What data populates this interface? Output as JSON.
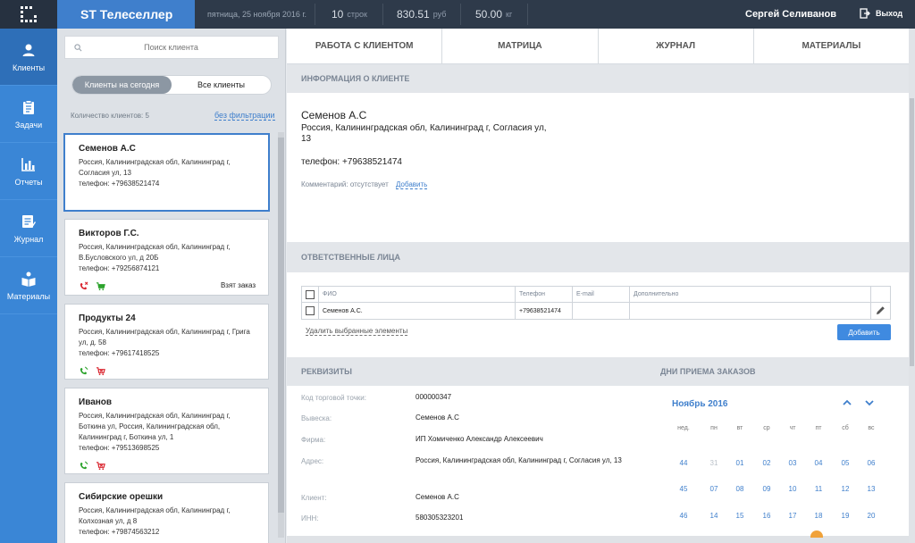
{
  "topbar": {
    "app_name": "ST Телеселлер",
    "date": "пятница, 25 ноября 2016 г.",
    "rows_count": "10",
    "rows_label": "строк",
    "sum_value": "830.51",
    "sum_unit": "руб",
    "weight_value": "50.00",
    "weight_unit": "кг",
    "user_name": "Сергей Селиванов",
    "logout_label": "Выход"
  },
  "sidebar": {
    "items": [
      {
        "label": "Клиенты",
        "icon": "person-icon"
      },
      {
        "label": "Задачи",
        "icon": "clipboard-icon"
      },
      {
        "label": "Отчеты",
        "icon": "bar-chart-icon"
      },
      {
        "label": "Журнал",
        "icon": "journal-icon"
      },
      {
        "label": "Материалы",
        "icon": "book-icon"
      }
    ]
  },
  "clients": {
    "search_placeholder": "Поиск клиента",
    "toggle_today": "Клиенты на сегодня",
    "toggle_all": "Все клиенты",
    "count_text": "Количество клиентов: 5",
    "no_filter": "без фильтрации",
    "cards": [
      {
        "name": "Семенов А.С",
        "address": "Россия, Калининградская обл, Калининград г, Согласия ул, 13",
        "phone": "телефон: +79638521474"
      },
      {
        "name": "Викторов Г.С.",
        "address": "Россия, Калининградская обл, Калининград г, В.Бусловского ул, д 20Б",
        "phone": "телефон: +79256874121",
        "status": "Взят заказ"
      },
      {
        "name": "Продукты 24",
        "address": "Россия, Калининградская обл, Калининград г, Грига ул, д. 58",
        "phone": "телефон: +79617418525"
      },
      {
        "name": "Иванов",
        "address": "Россия, Калининградская обл, Калининград г, Боткина ул, Россия, Калининградская обл, Калининград г, Боткина ул, 1",
        "phone": "телефон: +79513698525"
      },
      {
        "name": "Сибирские орешки",
        "address": "Россия, Калининградская обл, Калининград г, Колхозная ул, д 8",
        "phone": "телефон: +79874563212"
      }
    ]
  },
  "tabs": [
    "РАБОТА С КЛИЕНТОМ",
    "МАТРИЦА",
    "ЖУРНАЛ",
    "МАТЕРИАЛЫ"
  ],
  "client_info": {
    "header": "ИНФОРМАЦИЯ О КЛИЕНТЕ",
    "name": "Семенов А.С",
    "address_line1": "Россия, Калининградская обл, Калининград г, Согласия ул,",
    "address_line2": "13",
    "phone": "телефон: +79638521474",
    "comment": "Комментарий: отсутствует",
    "comment_add": "Добавить"
  },
  "responsible": {
    "header": "ОТВЕТСТВЕННЫЕ ЛИЦА",
    "columns": [
      "ФИО",
      "Телефон",
      "E-mail",
      "Дополнительно"
    ],
    "rows": [
      {
        "fio": "Семенов А.С.",
        "phone": "+79638521474",
        "email": "",
        "extra": ""
      }
    ],
    "delete_selected": "Удалить выбранные элементы",
    "add_button": "Добавить"
  },
  "requisites": {
    "header": "РЕКВИЗИТЫ",
    "fields": [
      {
        "label": "Код торговой точки:",
        "value": "000000347"
      },
      {
        "label": "Вывеска:",
        "value": "Семенов А.С"
      },
      {
        "label": "Фирма:",
        "value": "ИП Хомиченко Александр Алексеевич"
      },
      {
        "label": "Адрес:",
        "value": "Россия, Калининградская обл, Калининград г, Согласия ул, 13"
      },
      {
        "label": "Клиент:",
        "value": "Семенов А.С"
      },
      {
        "label": "ИНН:",
        "value": "580305323201"
      }
    ]
  },
  "calendar": {
    "header": "ДНИ ПРИЕМА ЗАКАЗОВ",
    "month": "Ноябрь 2016",
    "weekdays": [
      "нед.",
      "пн",
      "вт",
      "ср",
      "чт",
      "пт",
      "сб",
      "вс"
    ],
    "weeks": [
      [
        "44",
        "31",
        "01",
        "02",
        "03",
        "04",
        "05",
        "06"
      ],
      [
        "45",
        "07",
        "08",
        "09",
        "10",
        "11",
        "12",
        "13"
      ],
      [
        "46",
        "14",
        "15",
        "16",
        "17",
        "18",
        "19",
        "20"
      ]
    ],
    "colors": {
      "accent": "#3f7fcc",
      "muted": "#b9c0c8"
    }
  }
}
